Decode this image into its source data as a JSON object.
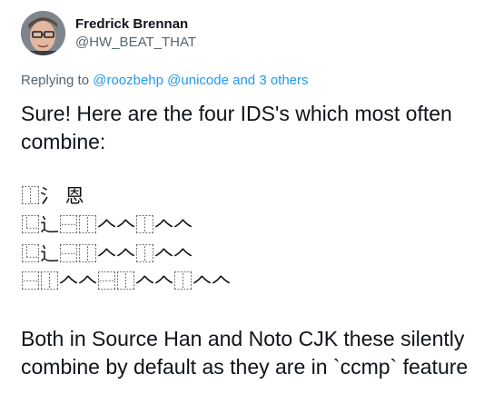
{
  "tweet": {
    "author": {
      "display_name": "Fredrick Brennan",
      "handle": "@HW_BEAT_THAT"
    },
    "reply": {
      "prefix": "Replying to",
      "mention_1": "@roozbehp",
      "mention_2": "@unicode",
      "others": "and 3 others"
    },
    "paragraph_1": "Sure! Here are the four IDS's which most often combine:",
    "ids_lines": [
      "⿰氵 恩",
      "⿺辶⿱⿰𠆢𠆢⿰𠆢𠆢",
      "⿺辶⿱⿰𠆢𠆢⿰𠆢𠆢",
      "⿱⿰𠆢𠆢⿱⿰𠆢𠆢⿰𠆢𠆢"
    ],
    "paragraph_2": "Both in Source Han and Noto CJK these silently combine by default as they are in `ccmp` feature"
  }
}
